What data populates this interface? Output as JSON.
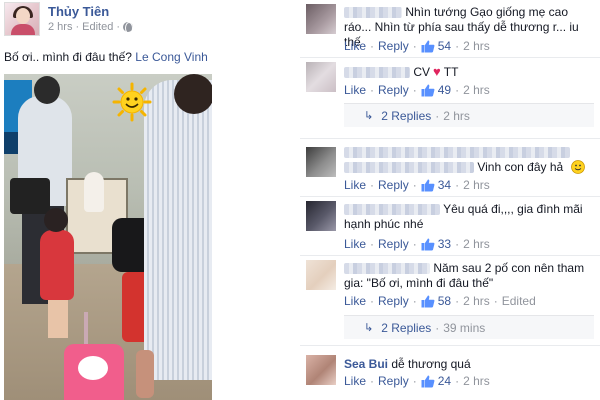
{
  "post": {
    "author": "Thủy Tiên",
    "time": "2 hrs",
    "edited": "Edited",
    "text": "Bố ơi.. mình đi đâu thế?",
    "tagged_name": "Le Cong Vinh"
  },
  "comments": [
    {
      "name": "",
      "text": "Nhìn tướng Gạo giống mẹ cao ráo... Nhìn từ phía sau thấy dễ thương r... iu thế",
      "like": "Like",
      "reply": "Reply",
      "likes": "54",
      "time": "2 hrs"
    },
    {
      "name": "",
      "text_before": "CV",
      "text_after": "TT",
      "like": "Like",
      "reply": "Reply",
      "likes": "49",
      "time": "2 hrs",
      "replies_label": "2 Replies",
      "replies_time": "2 hrs"
    },
    {
      "name": "",
      "text": "Vinh con đây hả",
      "like": "Like",
      "reply": "Reply",
      "likes": "34",
      "time": "2 hrs"
    },
    {
      "name": "",
      "text": "Yêu quá đi,,,, gia đình mãi hạnh phúc nhé",
      "like": "Like",
      "reply": "Reply",
      "likes": "33",
      "time": "2 hrs"
    },
    {
      "name": "",
      "text": "Năm sau 2 pố con nên tham gia: \"Bố ơi, mình đi đâu thế\"",
      "like": "Like",
      "reply": "Reply",
      "likes": "58",
      "time": "2 hrs",
      "edited": "Edited",
      "replies_label": "2 Replies",
      "replies_time": "39 mins"
    },
    {
      "name": "Sea Bui",
      "text": "dễ thương quá",
      "like": "Like",
      "reply": "Reply",
      "likes": "24",
      "time": "2 hrs"
    }
  ],
  "icons": {
    "post_privacy": "globe-icon",
    "reaction": "sun-emoji-icon",
    "like": "thumbs-up-icon",
    "smiley": "smiley-emoji-icon",
    "heart": "heart-icon"
  },
  "colors": {
    "link": "#3b5998",
    "meta": "#90949c",
    "heart": "#e0245e"
  }
}
